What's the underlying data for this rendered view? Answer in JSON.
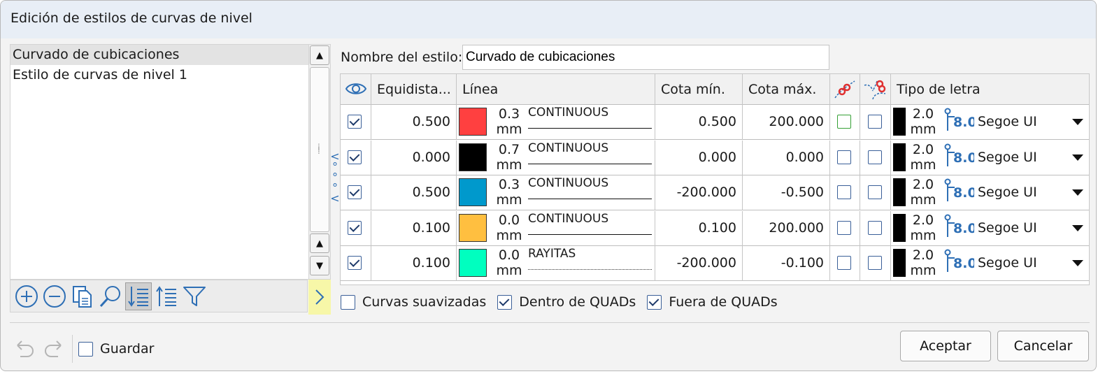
{
  "window": {
    "title": "Edición de estilos de curvas de nivel"
  },
  "style_list": {
    "items": [
      "Curvado de cubicaciones",
      "Estilo de curvas de nivel 1"
    ],
    "selected_index": 0
  },
  "toolbar_icons": [
    "add-circle-icon",
    "remove-circle-icon",
    "copy-icon",
    "search-icon",
    "sort-descending-icon",
    "sort-ascending-icon",
    "filter-icon"
  ],
  "style_name": {
    "label": "Nombre del estilo:",
    "value": "Curvado de cubicaciones"
  },
  "grid": {
    "headers": {
      "visible": "eye-icon",
      "equidist": "Equidista...",
      "linea": "Línea",
      "cota_min": "Cota mín.",
      "cota_max": "Cota máx.",
      "smooth": "link-curve-icon",
      "split": "link-split-icon",
      "font": "Tipo de letra"
    },
    "rows": [
      {
        "visible": true,
        "equidist": "0.500",
        "color": "#ff4040",
        "width": "0.3",
        "unit": "mm",
        "linetype": "CONTINUOUS",
        "dotted": false,
        "cota_min": "0.500",
        "cota_max": "200.000",
        "smooth": false,
        "split": false,
        "font_size": "2.0",
        "font_unit": "mm",
        "font_height": "8.0",
        "font_name": "Segoe UI"
      },
      {
        "visible": true,
        "equidist": "0.000",
        "color": "#000000",
        "width": "0.7",
        "unit": "mm",
        "linetype": "CONTINUOUS",
        "dotted": false,
        "cota_min": "0.000",
        "cota_max": "0.000",
        "smooth": false,
        "split": false,
        "font_size": "2.0",
        "font_unit": "mm",
        "font_height": "8.0",
        "font_name": "Segoe UI"
      },
      {
        "visible": true,
        "equidist": "0.500",
        "color": "#0099cc",
        "width": "0.3",
        "unit": "mm",
        "linetype": "CONTINUOUS",
        "dotted": false,
        "cota_min": "-200.000",
        "cota_max": "-0.500",
        "smooth": false,
        "split": false,
        "font_size": "2.0",
        "font_unit": "mm",
        "font_height": "8.0",
        "font_name": "Segoe UI"
      },
      {
        "visible": true,
        "equidist": "0.100",
        "color": "#ffbf40",
        "width": "0.0",
        "unit": "mm",
        "linetype": "CONTINUOUS",
        "dotted": false,
        "cota_min": "0.100",
        "cota_max": "200.000",
        "smooth": false,
        "split": false,
        "font_size": "2.0",
        "font_unit": "mm",
        "font_height": "8.0",
        "font_name": "Segoe UI"
      },
      {
        "visible": true,
        "equidist": "0.100",
        "color": "#00ffbf",
        "width": "0.0",
        "unit": "mm",
        "linetype": "RAYITAS",
        "dotted": true,
        "cota_min": "-200.000",
        "cota_max": "-0.100",
        "smooth": false,
        "split": false,
        "font_size": "2.0",
        "font_unit": "mm",
        "font_height": "8.0",
        "font_name": "Segoe UI"
      }
    ]
  },
  "options": [
    {
      "label": "Curvas suavizadas",
      "checked": false
    },
    {
      "label": "Dentro de QUADs",
      "checked": true
    },
    {
      "label": "Fuera de QUADs",
      "checked": true
    }
  ],
  "footer": {
    "save_label": "Guardar",
    "save_checked": false,
    "accept_label": "Aceptar",
    "cancel_label": "Cancelar"
  }
}
